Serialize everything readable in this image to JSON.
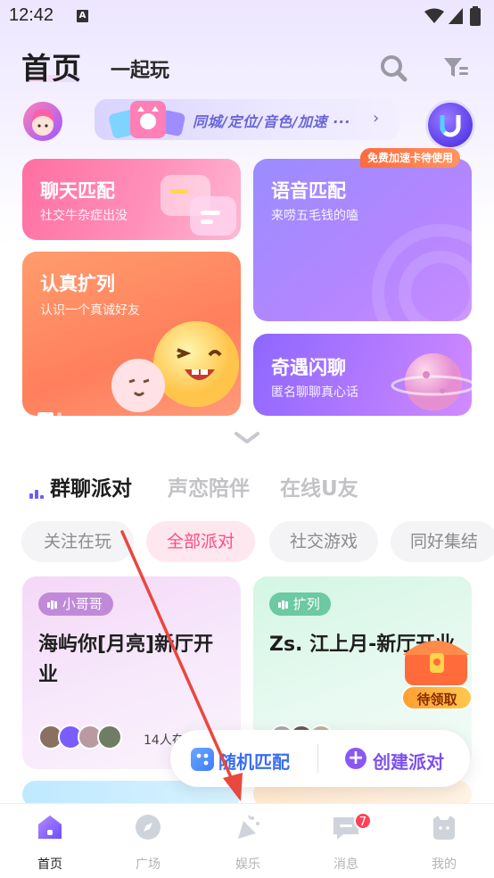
{
  "status_bar": {
    "time": "12:42",
    "notify_glyph": "A"
  },
  "header": {
    "title": "首页",
    "tab2": "一起玩",
    "search_icon": "search-icon",
    "filter_icon": "filter-icon"
  },
  "banner": {
    "text": "同城/定位/音色/加速 ···",
    "arrow": "›"
  },
  "cards": {
    "chat": {
      "title": "聊天匹配",
      "subtitle": "社交牛杂症出没"
    },
    "voice": {
      "title": "语音匹配",
      "subtitle": "来唠五毛钱的嗑",
      "badge": "免费加速卡待使用"
    },
    "friend": {
      "title": "认真扩列",
      "subtitle": "认识一个真诚好友"
    },
    "flash": {
      "title": "奇遇闪聊",
      "subtitle": "匿名聊聊真心话"
    }
  },
  "categories": [
    "群聊派对",
    "声恋陪伴",
    "在线U友"
  ],
  "chips": [
    "关注在玩",
    "全部派对",
    "社交游戏",
    "同好集结"
  ],
  "parties": [
    {
      "tag": "小哥哥",
      "title": "海屿你[月亮]新厅开业",
      "count": "14人在"
    },
    {
      "tag": "扩列",
      "title": "Zs. 江上月-新厅开业"
    }
  ],
  "treasure": {
    "label": "待领取"
  },
  "fab": {
    "random": "随机匹配",
    "create": "创建派对",
    "plus": "+"
  },
  "nav": {
    "home": "首页",
    "square": "广场",
    "fun": "娱乐",
    "messages": "消息",
    "messages_badge": "7",
    "mine": "我的"
  },
  "colors": {
    "accent": "#ff4c83",
    "purple": "#7b4ff0",
    "annotation": "#e8483e"
  }
}
